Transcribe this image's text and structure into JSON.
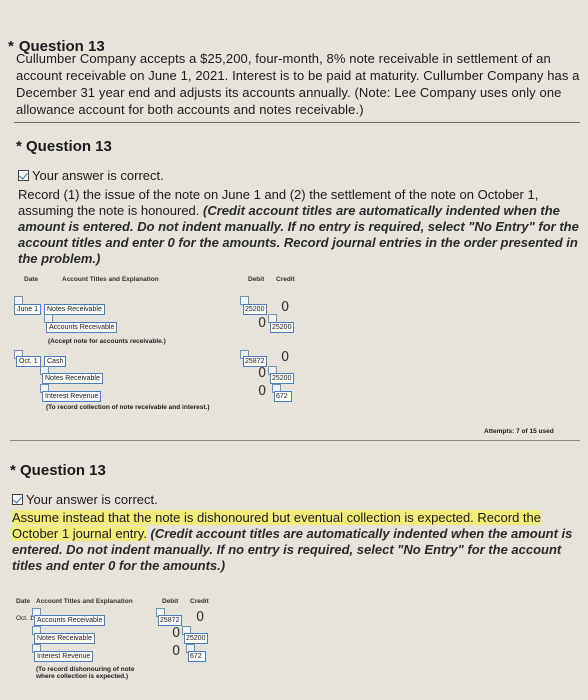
{
  "header": {
    "star": "*",
    "title": "Question 13",
    "text": "Cullumber Company accepts a $25,200, four-month, 8% note receivable in settlement of an account receivable on June 1, 2021. Interest is to be paid at maturity. Cullumber Company has a December 31 year end and adjusts its accounts annually. (Note: Lee Company uses only one allowance account for both accounts and notes receivable.)"
  },
  "part1": {
    "star": "*",
    "title": "Question 13",
    "correct": "Your answer is correct.",
    "instr_plain": "Record (1) the issue of the note on June 1 and (2) the settlement of the note on October 1, assuming the note is honoured.",
    "instr_em": "(Credit account titles are automatically indented when the amount is entered. Do not indent manually. If no entry is required, select \"No Entry\" for the account titles and enter 0 for the amounts. Record journal entries in the order presented in the problem.)",
    "col_date": "Date",
    "col_account": "Account Titles and Explanation",
    "col_debit": "Debit",
    "col_credit": "Credit",
    "rows": [
      {
        "date": "June 1",
        "account": "Notes Receivable",
        "debit": "25200",
        "credit": "0"
      },
      {
        "account": "Accounts Receivable",
        "debit": "0",
        "credit": "25200"
      },
      {
        "note": "(Accept note for accounts receivable.)"
      },
      {
        "date": "Oct. 1",
        "account": "Cash",
        "debit": "25872",
        "credit": "0"
      },
      {
        "account": "Notes Receivable",
        "debit": "0",
        "credit": "25200"
      },
      {
        "account": "Interest Revenue",
        "debit": "0",
        "credit": "672"
      },
      {
        "note": "(To record collection of note receivable and interest.)"
      }
    ],
    "attempts": "Attempts: 7 of 15 used"
  },
  "part2": {
    "star": "*",
    "title": "Question 13",
    "correct": "Your answer is correct.",
    "instr_plain": "Assume instead that the note is dishonoured but eventual collection is expected. Record the October 1 journal entry.",
    "instr_em": "(Credit account titles are automatically indented when the amount is entered. Do not indent manually. If no entry is required, select \"No Entry\" for the account titles and enter 0 for the amounts.)",
    "col_date": "Date",
    "col_account": "Account Titles and Explanation",
    "col_debit": "Debit",
    "col_credit": "Credit",
    "rows": [
      {
        "date": "Oct. 1",
        "account": "Accounts Receivable",
        "debit": "25872",
        "credit": "0"
      },
      {
        "account": "Notes Receivable",
        "debit": "0",
        "credit": "25200"
      },
      {
        "account": "Interest Revenue",
        "debit": "0",
        "credit": "672"
      }
    ],
    "note_line1": "(To record dishonouring of note",
    "note_line2": "where collection is expected.)"
  },
  "colors": {
    "highlight": "#f2ec7a",
    "field_border": "#4a7ebf",
    "background": "#e6e3db"
  }
}
